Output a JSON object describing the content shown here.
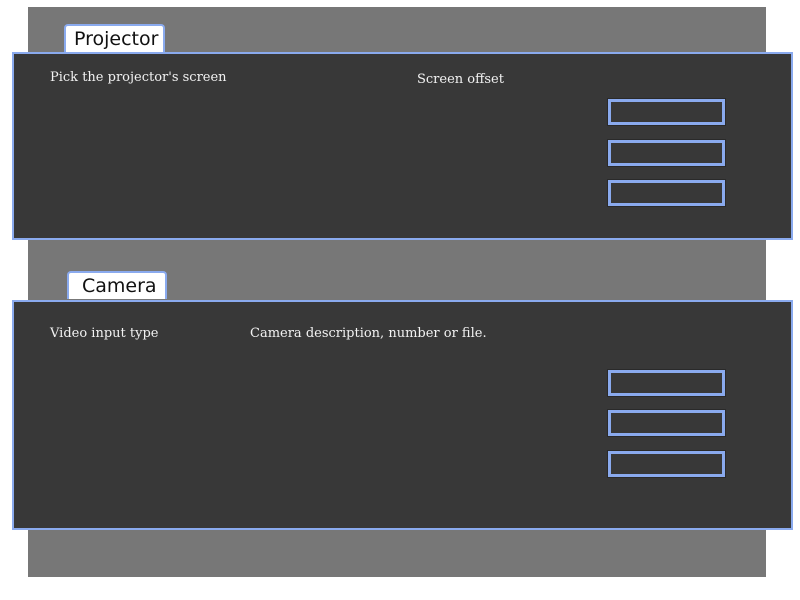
{
  "projector": {
    "tab_label": "Projector",
    "screen_label": "Pick the projector's screen",
    "offset_label": "Screen offset",
    "fields": [
      "",
      "",
      ""
    ]
  },
  "camera": {
    "tab_label": "Camera",
    "input_type_label": "Video input type",
    "description_label": "Camera description, number or file.",
    "fields": [
      "",
      "",
      ""
    ]
  },
  "colors": {
    "panel_bg": "#383838",
    "accent_border": "#8aaaee",
    "backdrop": "#777777"
  }
}
